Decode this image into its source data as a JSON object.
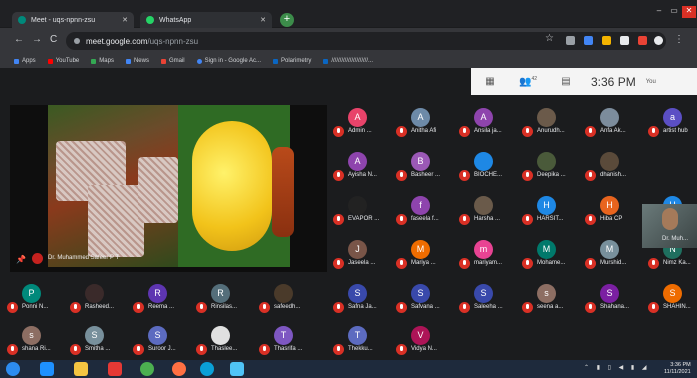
{
  "browser": {
    "tabs": [
      {
        "label": "Meet - uqs-npnn-zsu",
        "icon_color": "#00897b"
      },
      {
        "label": "WhatsApp",
        "icon_color": "#25d366"
      }
    ],
    "new_tab": "+",
    "window_controls": {
      "minimize": "–",
      "maximize": "▭",
      "close": "✕"
    },
    "nav": {
      "back": "←",
      "forward": "→",
      "reload": "C"
    },
    "url_host": "meet.google.com",
    "url_path": "/uqs-npnn-zsu",
    "bookmarks": [
      "Apps",
      "YouTube",
      "Maps",
      "News",
      "Gmail",
      "Sign in - Google Ac...",
      "Polarimetry",
      "//////////////////////..."
    ],
    "bookmark_colors": [
      "#4285f4",
      "#ff0000",
      "#34a853",
      "#4285f4",
      "#ea4335",
      "#4285f4",
      "#0a66c2",
      "#0a66c2"
    ]
  },
  "meet": {
    "toolbar": {
      "grid_icon": "▦",
      "people_icon": "👥",
      "people_count": "42",
      "chat_icon": "▤",
      "time": "3:36 PM",
      "you_label": "You"
    },
    "presenter_name": "Dr. Muhammed Safeer P T"
  },
  "participants": [
    {
      "name": "Admin ...",
      "initial": "A",
      "color": "#e8436a"
    },
    {
      "name": "Anitha Afi",
      "initial": "A",
      "color": "#6d8aa8"
    },
    {
      "name": "Ansila ja...",
      "initial": "A",
      "color": "#8e44ad"
    },
    {
      "name": "Anurudh...",
      "initial": "",
      "color": "#6b5a4a"
    },
    {
      "name": "Anfa Ak...",
      "initial": "",
      "color": "#7c8c9c"
    },
    {
      "name": "artist hub",
      "initial": "a",
      "color": "#5b4fc4"
    },
    {
      "name": "Ayisha N...",
      "initial": "A",
      "color": "#8e44ad"
    },
    {
      "name": "Basheer ...",
      "initial": "B",
      "color": "#9b59b6"
    },
    {
      "name": "BIOCHE...",
      "initial": "",
      "color": "#1e88e5"
    },
    {
      "name": "Deepika ...",
      "initial": "",
      "color": "#4a5a3a"
    },
    {
      "name": "dhanish...",
      "initial": "",
      "color": "#5a4a3a"
    },
    {
      "name": "Dr. Muh...",
      "initial": "",
      "color": "#3b4444"
    },
    {
      "name": "EVAPOR ...",
      "initial": "",
      "color": "#222222"
    },
    {
      "name": "faseela f...",
      "initial": "f",
      "color": "#8e44ad"
    },
    {
      "name": "Harsha ...",
      "initial": "",
      "color": "#6a5a4a"
    },
    {
      "name": "HARSIT...",
      "initial": "H",
      "color": "#1e88e5"
    },
    {
      "name": "Hiba CP",
      "initial": "H",
      "color": "#e8641e"
    },
    {
      "name": "Hudha J...",
      "initial": "H",
      "color": "#1e88e5"
    },
    {
      "name": "Jaseela ...",
      "initial": "J",
      "color": "#795548"
    },
    {
      "name": "Mariya ...",
      "initial": "M",
      "color": "#ef6c00"
    },
    {
      "name": "mariyam...",
      "initial": "m",
      "color": "#e84393"
    },
    {
      "name": "Mohame...",
      "initial": "M",
      "color": "#00796b"
    },
    {
      "name": "Murshid...",
      "initial": "M",
      "color": "#78909c"
    },
    {
      "name": "Nimz Ka...",
      "initial": "N",
      "color": "#1f6f5f"
    },
    {
      "name": "Ponni N...",
      "initial": "P",
      "color": "#00897b"
    },
    {
      "name": "Rasheed...",
      "initial": "",
      "color": "#3a2a2a"
    },
    {
      "name": "Reema ...",
      "initial": "R",
      "color": "#5e35b1"
    },
    {
      "name": "Rinsilas...",
      "initial": "R",
      "color": "#546e7a"
    },
    {
      "name": "safeedh...",
      "initial": "",
      "color": "#4a3a2a"
    },
    {
      "name": "Safna Ja...",
      "initial": "S",
      "color": "#3949ab"
    },
    {
      "name": "Safvana ...",
      "initial": "S",
      "color": "#3949ab"
    },
    {
      "name": "Saleeha ...",
      "initial": "S",
      "color": "#3949ab"
    },
    {
      "name": "seena a...",
      "initial": "s",
      "color": "#8d6e63"
    },
    {
      "name": "Shahana...",
      "initial": "S",
      "color": "#7b1fa2"
    },
    {
      "name": "SHAHIN...",
      "initial": "S",
      "color": "#ef6c00"
    },
    {
      "name": "shana Ri...",
      "initial": "s",
      "color": "#8d6e63"
    },
    {
      "name": "Smitha ...",
      "initial": "S",
      "color": "#78909c"
    },
    {
      "name": "Suroor J...",
      "initial": "S",
      "color": "#5c6bc0"
    },
    {
      "name": "Thaslee...",
      "initial": "",
      "color": "#e0e0e0"
    },
    {
      "name": "Thasrifa ...",
      "initial": "T",
      "color": "#7e57c2"
    },
    {
      "name": "Thekku...",
      "initial": "T",
      "color": "#5c6bc0"
    },
    {
      "name": "Vidya N...",
      "initial": "V",
      "color": "#ad1457"
    }
  ],
  "taskbar": {
    "apps": [
      "start-button",
      "ie-icon",
      "explorer-icon",
      "media-icon",
      "chrome-icon",
      "firefox-icon",
      "opera-icon",
      "paint-icon"
    ],
    "app_colors": [
      "#2d8cf0",
      "#1e90ff",
      "#f4c542",
      "#e53935",
      "#4caf50",
      "#ff7043",
      "#0aa0d8",
      "#4fc3f7"
    ],
    "tray": "⌃ ▮ ▯ ◀ ▮ ◢",
    "time": "3:36 PM",
    "date": "11/11/2021"
  }
}
